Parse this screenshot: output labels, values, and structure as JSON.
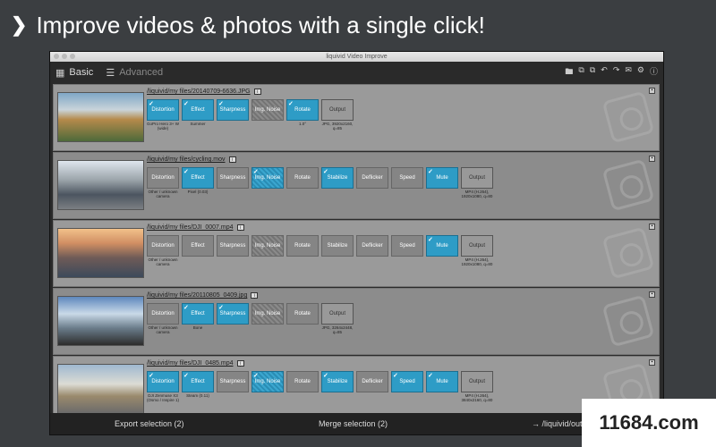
{
  "headline": "Improve videos & photos with a single click!",
  "window": {
    "title": "liquivid Video Improve"
  },
  "toolbar": {
    "basic": "Basic",
    "advanced": "Advanced"
  },
  "rows": [
    {
      "path": "/liquivid/my files/20140709-6636.JPG",
      "thumb": "linear-gradient(180deg,#7fa7c6 0%,#c9d4da 35%,#b58a4b 55%,#4e6a3a 100%)",
      "ops": [
        {
          "label": "Distortion",
          "state": "on",
          "sub": "GoPro Hero 3+ W\n(wide)"
        },
        {
          "label": "Effect",
          "state": "on",
          "sub": "Summer"
        },
        {
          "label": "Sharpness",
          "state": "on",
          "sub": ""
        },
        {
          "label": "Img. Noise",
          "state": "noise",
          "sub": ""
        },
        {
          "label": "Rotate",
          "state": "on",
          "sub": "1.0°"
        },
        {
          "label": "Output",
          "state": "out",
          "sub": "JPG, 3920x2160,\nq=85"
        }
      ]
    },
    {
      "path": "/liquivid/my files/cycling.mov",
      "thumb": "linear-gradient(180deg,#dfe6ee 0%,#9aa3a9 40%,#4c5560 70%,#7b7f83 100%)",
      "ops": [
        {
          "label": "Distortion",
          "state": "off",
          "sub": "Other / unknown\ncamera"
        },
        {
          "label": "Effect",
          "state": "on",
          "sub": "Pixel (0.03)"
        },
        {
          "label": "Sharpness",
          "state": "off",
          "sub": ""
        },
        {
          "label": "Img. Noise",
          "state": "on noise",
          "sub": ""
        },
        {
          "label": "Rotate",
          "state": "off",
          "sub": ""
        },
        {
          "label": "Stabilize",
          "state": "on",
          "sub": ""
        },
        {
          "label": "Deflicker",
          "state": "off",
          "sub": ""
        },
        {
          "label": "Speed",
          "state": "off",
          "sub": ""
        },
        {
          "label": "Mute",
          "state": "on",
          "sub": ""
        },
        {
          "label": "Output",
          "state": "out",
          "sub": "MP4 (H.264),\n1920x1080, q=80"
        }
      ]
    },
    {
      "path": "/liquivid/my files/DJI_0007.mp4",
      "thumb": "linear-gradient(180deg,#f2c18a 0%,#d08e63 30%,#6f5b57 60%,#3c4a5b 100%)",
      "ops": [
        {
          "label": "Distortion",
          "state": "off",
          "sub": "Other / unknown\ncamera"
        },
        {
          "label": "Effect",
          "state": "off",
          "sub": ""
        },
        {
          "label": "Sharpness",
          "state": "off",
          "sub": ""
        },
        {
          "label": "Img. Noise",
          "state": "noise",
          "sub": ""
        },
        {
          "label": "Rotate",
          "state": "off",
          "sub": ""
        },
        {
          "label": "Stabilize",
          "state": "off",
          "sub": ""
        },
        {
          "label": "Deflicker",
          "state": "off",
          "sub": ""
        },
        {
          "label": "Speed",
          "state": "off",
          "sub": ""
        },
        {
          "label": "Mute",
          "state": "on",
          "sub": ""
        },
        {
          "label": "Output",
          "state": "out",
          "sub": "MP4 (H.264),\n1920x1080, q=80"
        }
      ]
    },
    {
      "path": "/liquivid/my files/20110805_0409.jpg",
      "thumb": "linear-gradient(180deg,#5d87bd 0%,#c9d9e8 35%,#6a7c8a 65%,#2c2c2c 100%)",
      "ops": [
        {
          "label": "Distortion",
          "state": "off",
          "sub": "Other / unknown\ncamera"
        },
        {
          "label": "Effect",
          "state": "on",
          "sub": "Bone"
        },
        {
          "label": "Sharpness",
          "state": "on",
          "sub": ""
        },
        {
          "label": "Img. Noise",
          "state": "noise",
          "sub": ""
        },
        {
          "label": "Rotate",
          "state": "off",
          "sub": ""
        },
        {
          "label": "Output",
          "state": "out",
          "sub": "JPG, 3264x2448,\nq=85"
        }
      ]
    },
    {
      "path": "/liquivid/my files/DJI_0485.mp4",
      "thumb": "linear-gradient(180deg,#9fb8d0 0%,#dcdcd4 40%,#9a8a6c 65%,#6b6b6b 100%)",
      "ops": [
        {
          "label": "Distortion",
          "state": "on",
          "sub": "DJI Zenmuse X3\n(Osmo / Inspire 1)"
        },
        {
          "label": "Effect",
          "state": "on",
          "sub": "Steam (0.11)"
        },
        {
          "label": "Sharpness",
          "state": "off",
          "sub": ""
        },
        {
          "label": "Img. Noise",
          "state": "on noise",
          "sub": ""
        },
        {
          "label": "Rotate",
          "state": "off",
          "sub": ""
        },
        {
          "label": "Stabilize",
          "state": "on",
          "sub": ""
        },
        {
          "label": "Deflicker",
          "state": "off",
          "sub": ""
        },
        {
          "label": "Speed",
          "state": "on",
          "sub": ""
        },
        {
          "label": "Mute",
          "state": "on",
          "sub": ""
        },
        {
          "label": "Output",
          "state": "out",
          "sub": "MP4 (H.264),\n3840x2160, q=80"
        }
      ]
    }
  ],
  "footer": {
    "export": "Export selection (2)",
    "merge": "Merge selection (2)",
    "output": "→ /liquivid/out"
  },
  "watermark": "11684.com"
}
